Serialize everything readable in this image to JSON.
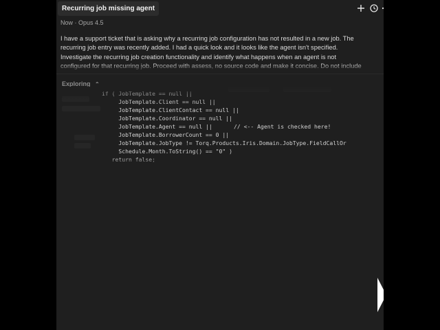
{
  "header": {
    "title": "Recurring job missing agent",
    "new_icon": "plus-icon",
    "history_icon": "clock-icon",
    "more_icon": "ellipsis-icon"
  },
  "meta": "Now · Opus 4.5",
  "prompt": {
    "lines": [
      "I have a support ticket that is asking why a recurring job configuration has not resulted in a new job. The",
      "recurring job entry was recently added. I had a quick look and it looks like the agent isn't specified.",
      "Investigate the recurring job creation functionality and identify what happens when an agent is not",
      "configured for that recurring job. Proceed with assess, no source code and make it concise. Do not include"
    ]
  },
  "exploring": {
    "label": "Exploring",
    "chevron_icon": "chevron-up-icon"
  },
  "code": {
    "lines": [
      "if ( JobTemplate == null ||",
      "     JobTemplate.Client == null ||",
      "     JobTemplate.ClientContact == null ||",
      "     JobTemplate.Coordinator == null ||",
      "     JobTemplate.Agent == null ||",
      "     JobTemplate.BorrowerCount == 0 ||",
      "     JobTemplate.JobType != Torq.Products.Iris.Domain.JobType.FieldCallOr",
      "     Schedule.Month.ToString() == \"0\" )",
      "   return false;"
    ],
    "agent_comment": "// <-- Agent is checked here!"
  },
  "colors": {
    "panel_bg": "#1f1f1f",
    "page_bg": "#000000",
    "text": "#dcdcdc",
    "muted": "#a8a8a8"
  }
}
